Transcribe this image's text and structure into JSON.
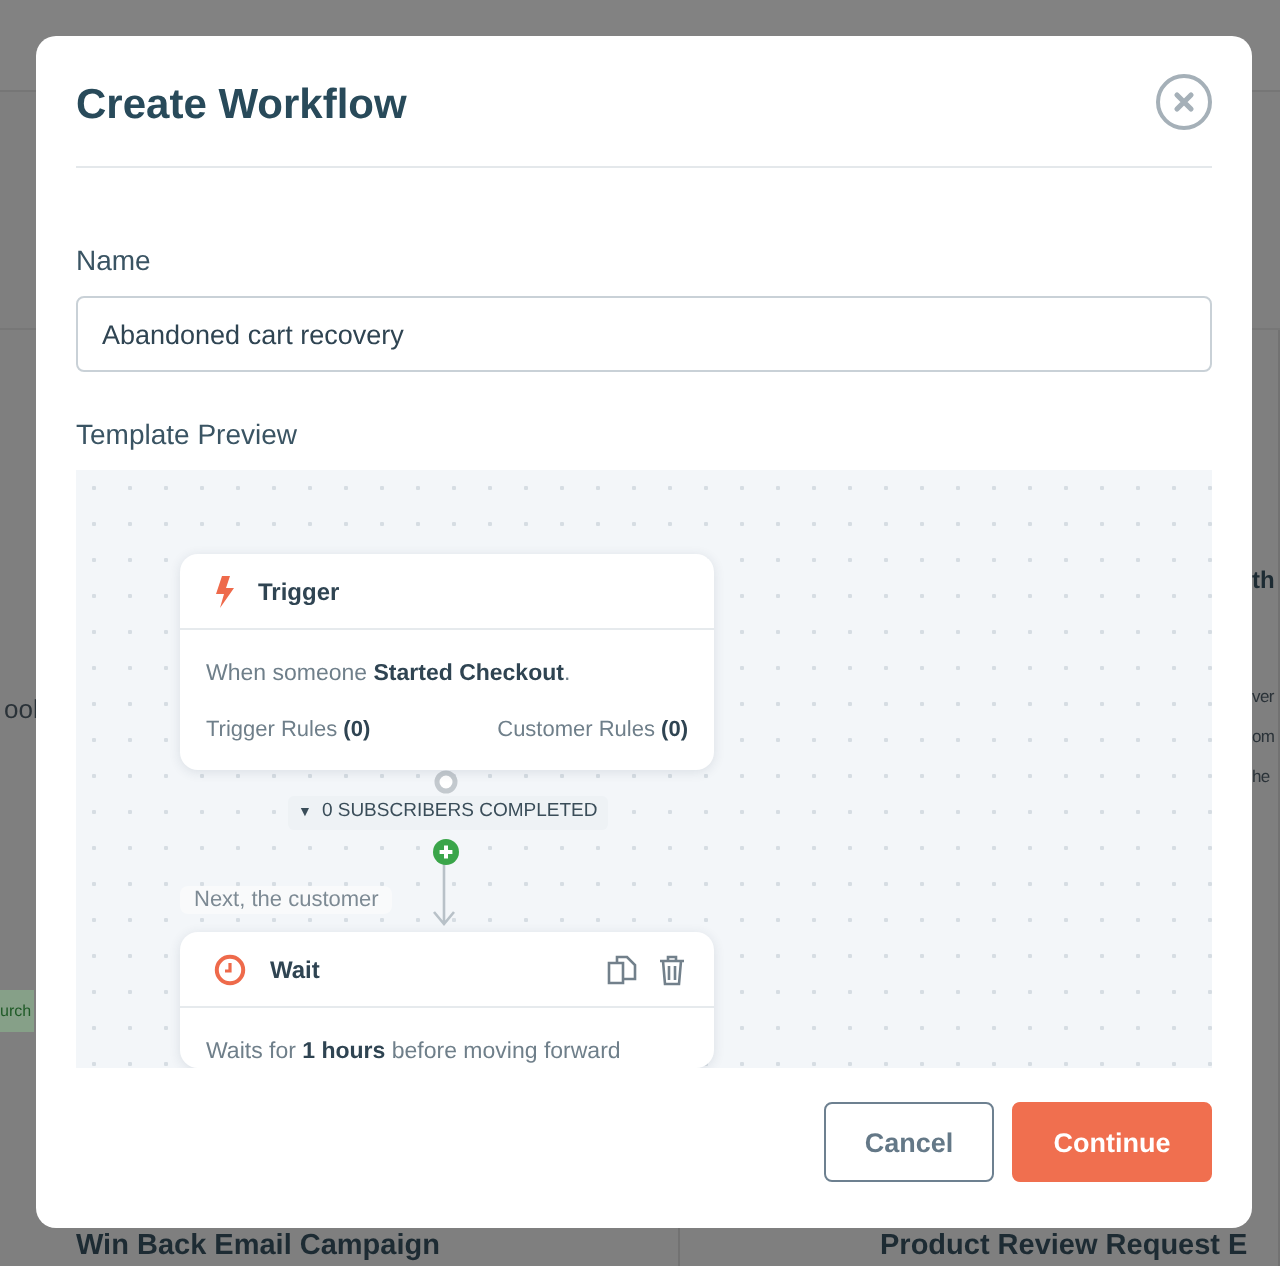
{
  "background": {
    "left_fragments": [
      "ool"
    ],
    "left_badge": "urch",
    "right_heading": "th",
    "right_lines": [
      "ver",
      "om",
      "he"
    ],
    "card_titles": [
      "Win Back Email Campaign",
      "Product Review Request E"
    ]
  },
  "dialog": {
    "title": "Create Workflow",
    "name_field": {
      "label": "Name",
      "value": "Abandoned cart recovery"
    },
    "preview": {
      "label": "Template Preview",
      "trigger": {
        "title": "Trigger",
        "description": "When someone **Started Checkout**.",
        "rules": [
          "Trigger Rules **(0)**",
          "Customer Rules **(0)**"
        ]
      },
      "connector": {
        "caret": "▼",
        "label": "0 SUBSCRIBERS COMPLETED"
      },
      "branch_label": "Next, the customer",
      "steps": [
        {
          "kind": "wait",
          "title": "Wait",
          "description": "Waits for **1 hours** before moving forward"
        }
      ]
    },
    "buttons": [
      {
        "label": "Cancel",
        "kind": "secondary"
      },
      {
        "label": "Continue",
        "kind": "primary"
      }
    ]
  }
}
